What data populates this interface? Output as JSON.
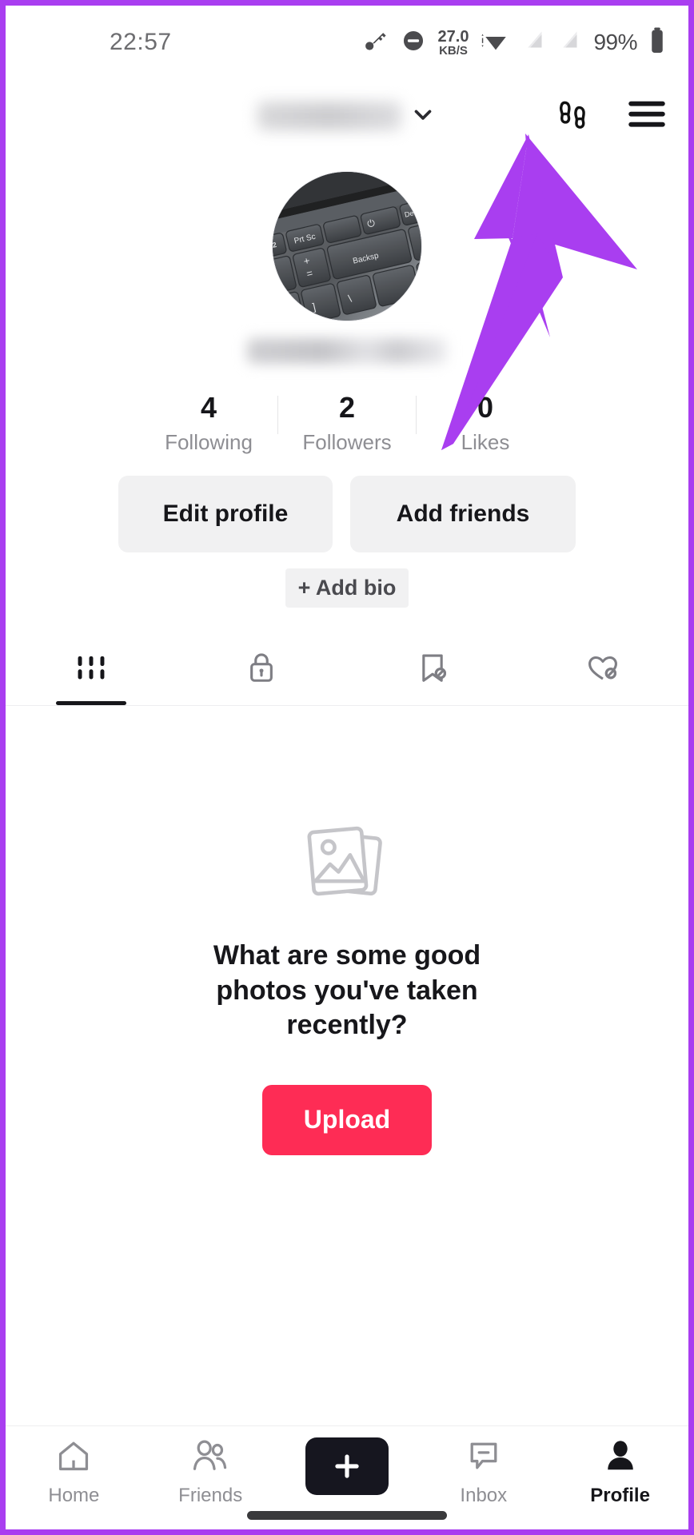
{
  "status_bar": {
    "time": "22:57",
    "network_speed_value": "27.0",
    "network_speed_unit": "KB/S",
    "battery_percent": "99%",
    "icons": [
      "vpn-key-icon",
      "do-not-disturb-icon",
      "wifi-icon",
      "sim-signal-icon",
      "sim-signal-2-icon",
      "battery-icon"
    ]
  },
  "top_bar": {
    "username": "",
    "username_hidden": true,
    "dropdown_icon": "chevron-down-icon",
    "footprints_icon": "footprints-icon",
    "menu_icon": "hamburger-menu-icon"
  },
  "profile": {
    "avatar_alt": "laptop-keyboard-photo",
    "handle": "",
    "handle_hidden": true,
    "stats": [
      {
        "count": "4",
        "label": "Following"
      },
      {
        "count": "2",
        "label": "Followers"
      },
      {
        "count": "0",
        "label": "Likes"
      }
    ],
    "edit_profile_label": "Edit profile",
    "add_friends_label": "Add friends",
    "add_bio_label": "+ Add bio"
  },
  "tabs": [
    {
      "name": "posts",
      "icon": "grid-posts-icon",
      "active": true
    },
    {
      "name": "private",
      "icon": "lock-icon",
      "active": false
    },
    {
      "name": "saved",
      "icon": "bookmark-hidden-icon",
      "active": false
    },
    {
      "name": "liked",
      "icon": "heart-hidden-icon",
      "active": false
    }
  ],
  "empty_state": {
    "icon": "photos-stack-icon",
    "message": "What are some good photos you've taken recently?",
    "upload_label": "Upload"
  },
  "bottom_nav": [
    {
      "label": "Home",
      "icon": "home-icon",
      "active": false
    },
    {
      "label": "Friends",
      "icon": "friends-icon",
      "active": false
    },
    {
      "label": "",
      "icon": "create-plus-icon",
      "active": false
    },
    {
      "label": "Inbox",
      "icon": "inbox-icon",
      "active": false
    },
    {
      "label": "Profile",
      "icon": "profile-person-icon",
      "active": true
    }
  ],
  "annotation": {
    "arrow_color": "#a93ef0",
    "points_to": "hamburger-menu-icon"
  },
  "colors": {
    "accent_red": "#fe2c55",
    "accent_cyan": "#25f4ee",
    "annotation_purple": "#a93ef0",
    "text_primary": "#16161a",
    "text_muted": "#8e8e93",
    "chip_bg": "#f1f1f2"
  }
}
